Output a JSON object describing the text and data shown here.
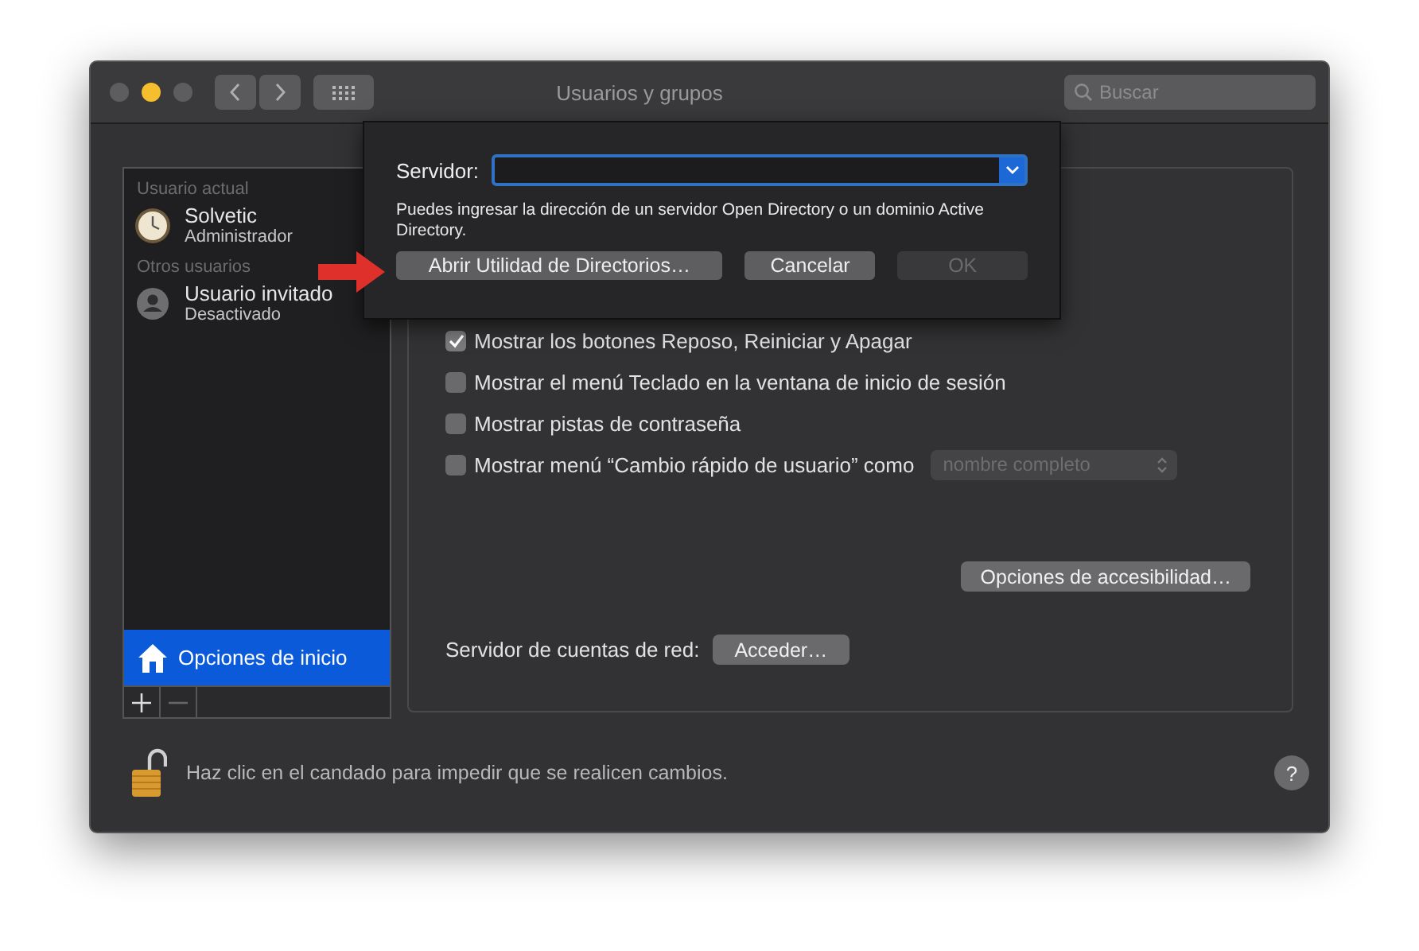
{
  "window": {
    "title": "Usuarios y grupos"
  },
  "search": {
    "placeholder": "Buscar"
  },
  "sidebar": {
    "sections": [
      {
        "header": "Usuario actual",
        "users": [
          {
            "name": "Solvetic",
            "role": "Administrador",
            "kind": "clock"
          }
        ]
      },
      {
        "header": "Otros usuarios",
        "users": [
          {
            "name": "Usuario invitado",
            "role": "Desactivado",
            "kind": "generic"
          }
        ]
      }
    ],
    "login_options": {
      "label": "Opciones de inicio",
      "selected": true
    }
  },
  "options": [
    {
      "label": "Mostrar los botones Reposo, Reiniciar y Apagar",
      "checked": true
    },
    {
      "label": "Mostrar el menú Teclado en la ventana de inicio de sesión",
      "checked": false
    },
    {
      "label": "Mostrar pistas de contraseña",
      "checked": false
    },
    {
      "label": "Mostrar menú “Cambio rápido de usuario” como",
      "checked": false,
      "popup": "nombre completo"
    }
  ],
  "accessibility_button": "Opciones de accesibilidad…",
  "network_server": {
    "label": "Servidor de cuentas de red:",
    "button": "Acceder…"
  },
  "lock_message": "Haz clic en el candado para impedir que se realicen cambios.",
  "help_button": "?",
  "dialog": {
    "server_label": "Servidor:",
    "hint": "Puedes ingresar la dirección de un servidor Open Directory o un dominio Active Directory.",
    "buttons": [
      {
        "label": "Abrir Utilidad de Directorios…",
        "kind": "normal"
      },
      {
        "label": "Cancelar",
        "kind": "normal"
      },
      {
        "label": "OK",
        "kind": "disabled"
      }
    ]
  }
}
